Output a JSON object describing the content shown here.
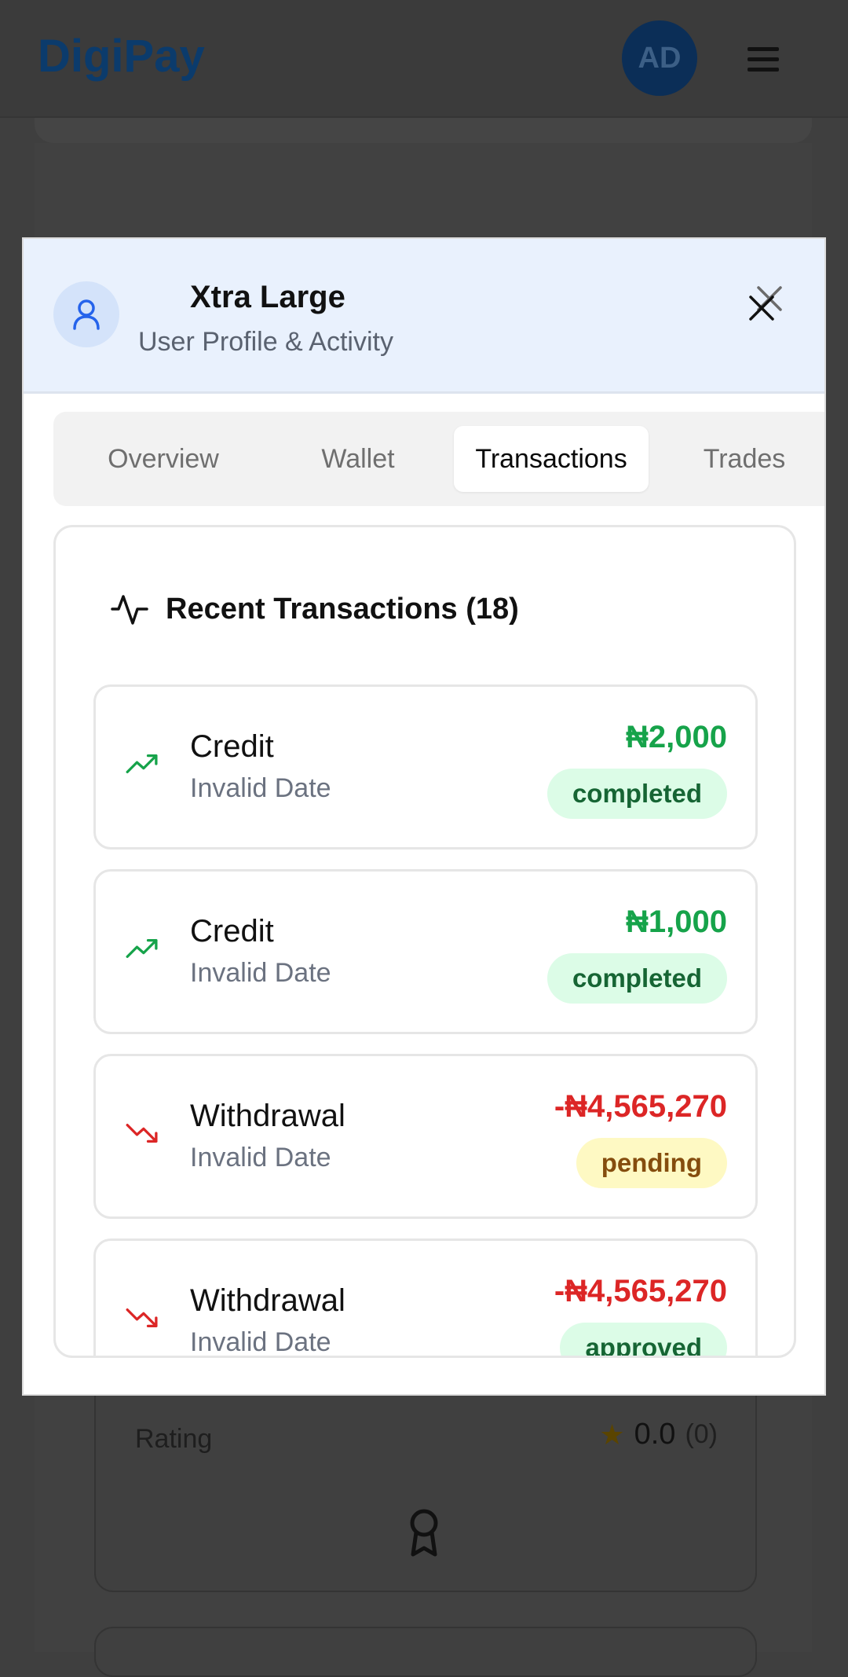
{
  "app": {
    "brand": "DigiPay",
    "avatar_initials": "AD"
  },
  "background": {
    "rating_label": "Rating",
    "rating_value": "0.0",
    "rating_count": "(0)"
  },
  "modal": {
    "title": "Xtra Large",
    "subtitle": "User Profile & Activity",
    "tabs": [
      {
        "label": "Overview",
        "active": false
      },
      {
        "label": "Wallet",
        "active": false
      },
      {
        "label": "Transactions",
        "active": true
      },
      {
        "label": "Trades",
        "active": false
      }
    ],
    "transactions_title": "Recent Transactions (18)",
    "transactions": [
      {
        "type": "Credit",
        "date": "Invalid Date",
        "amount": "₦2,000",
        "status": "completed",
        "direction": "up"
      },
      {
        "type": "Credit",
        "date": "Invalid Date",
        "amount": "₦1,000",
        "status": "completed",
        "direction": "up"
      },
      {
        "type": "Withdrawal",
        "date": "Invalid Date",
        "amount": "-₦4,565,270",
        "status": "pending",
        "direction": "down"
      },
      {
        "type": "Withdrawal",
        "date": "Invalid Date",
        "amount": "-₦4,565,270",
        "status": "approved",
        "direction": "down"
      }
    ]
  },
  "colors": {
    "brand": "#0b3b6c",
    "credit": "#16a34a",
    "debit": "#dc2626",
    "completed_bg": "#dcfce7",
    "completed_fg": "#166534",
    "pending_bg": "#fef9c3",
    "pending_fg": "#854d0e",
    "approved_bg": "#dcfce7",
    "approved_fg": "#166534"
  }
}
